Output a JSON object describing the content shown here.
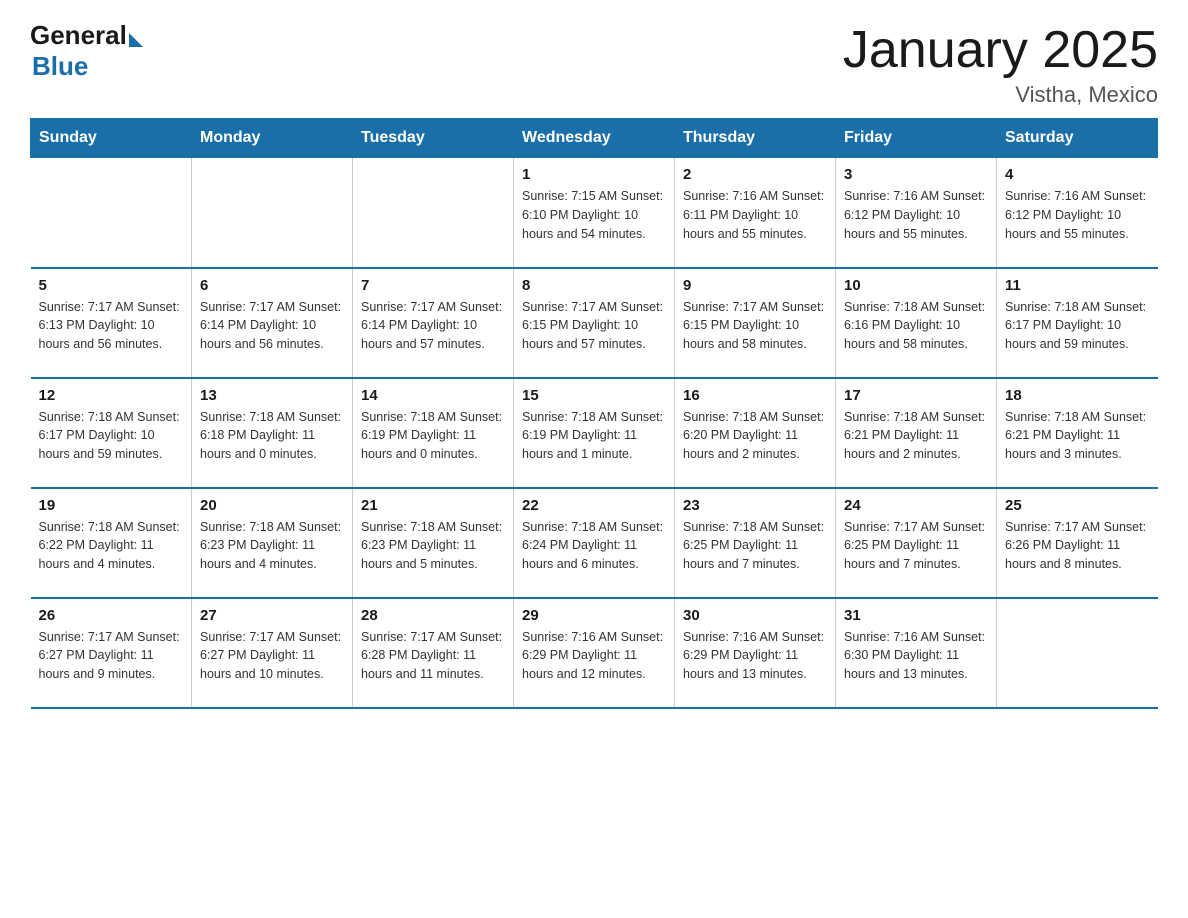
{
  "logo": {
    "general": "General",
    "blue": "Blue"
  },
  "title": "January 2025",
  "subtitle": "Vistha, Mexico",
  "days_of_week": [
    "Sunday",
    "Monday",
    "Tuesday",
    "Wednesday",
    "Thursday",
    "Friday",
    "Saturday"
  ],
  "weeks": [
    [
      {
        "day": "",
        "info": ""
      },
      {
        "day": "",
        "info": ""
      },
      {
        "day": "",
        "info": ""
      },
      {
        "day": "1",
        "info": "Sunrise: 7:15 AM\nSunset: 6:10 PM\nDaylight: 10 hours\nand 54 minutes."
      },
      {
        "day": "2",
        "info": "Sunrise: 7:16 AM\nSunset: 6:11 PM\nDaylight: 10 hours\nand 55 minutes."
      },
      {
        "day": "3",
        "info": "Sunrise: 7:16 AM\nSunset: 6:12 PM\nDaylight: 10 hours\nand 55 minutes."
      },
      {
        "day": "4",
        "info": "Sunrise: 7:16 AM\nSunset: 6:12 PM\nDaylight: 10 hours\nand 55 minutes."
      }
    ],
    [
      {
        "day": "5",
        "info": "Sunrise: 7:17 AM\nSunset: 6:13 PM\nDaylight: 10 hours\nand 56 minutes."
      },
      {
        "day": "6",
        "info": "Sunrise: 7:17 AM\nSunset: 6:14 PM\nDaylight: 10 hours\nand 56 minutes."
      },
      {
        "day": "7",
        "info": "Sunrise: 7:17 AM\nSunset: 6:14 PM\nDaylight: 10 hours\nand 57 minutes."
      },
      {
        "day": "8",
        "info": "Sunrise: 7:17 AM\nSunset: 6:15 PM\nDaylight: 10 hours\nand 57 minutes."
      },
      {
        "day": "9",
        "info": "Sunrise: 7:17 AM\nSunset: 6:15 PM\nDaylight: 10 hours\nand 58 minutes."
      },
      {
        "day": "10",
        "info": "Sunrise: 7:18 AM\nSunset: 6:16 PM\nDaylight: 10 hours\nand 58 minutes."
      },
      {
        "day": "11",
        "info": "Sunrise: 7:18 AM\nSunset: 6:17 PM\nDaylight: 10 hours\nand 59 minutes."
      }
    ],
    [
      {
        "day": "12",
        "info": "Sunrise: 7:18 AM\nSunset: 6:17 PM\nDaylight: 10 hours\nand 59 minutes."
      },
      {
        "day": "13",
        "info": "Sunrise: 7:18 AM\nSunset: 6:18 PM\nDaylight: 11 hours\nand 0 minutes."
      },
      {
        "day": "14",
        "info": "Sunrise: 7:18 AM\nSunset: 6:19 PM\nDaylight: 11 hours\nand 0 minutes."
      },
      {
        "day": "15",
        "info": "Sunrise: 7:18 AM\nSunset: 6:19 PM\nDaylight: 11 hours\nand 1 minute."
      },
      {
        "day": "16",
        "info": "Sunrise: 7:18 AM\nSunset: 6:20 PM\nDaylight: 11 hours\nand 2 minutes."
      },
      {
        "day": "17",
        "info": "Sunrise: 7:18 AM\nSunset: 6:21 PM\nDaylight: 11 hours\nand 2 minutes."
      },
      {
        "day": "18",
        "info": "Sunrise: 7:18 AM\nSunset: 6:21 PM\nDaylight: 11 hours\nand 3 minutes."
      }
    ],
    [
      {
        "day": "19",
        "info": "Sunrise: 7:18 AM\nSunset: 6:22 PM\nDaylight: 11 hours\nand 4 minutes."
      },
      {
        "day": "20",
        "info": "Sunrise: 7:18 AM\nSunset: 6:23 PM\nDaylight: 11 hours\nand 4 minutes."
      },
      {
        "day": "21",
        "info": "Sunrise: 7:18 AM\nSunset: 6:23 PM\nDaylight: 11 hours\nand 5 minutes."
      },
      {
        "day": "22",
        "info": "Sunrise: 7:18 AM\nSunset: 6:24 PM\nDaylight: 11 hours\nand 6 minutes."
      },
      {
        "day": "23",
        "info": "Sunrise: 7:18 AM\nSunset: 6:25 PM\nDaylight: 11 hours\nand 7 minutes."
      },
      {
        "day": "24",
        "info": "Sunrise: 7:17 AM\nSunset: 6:25 PM\nDaylight: 11 hours\nand 7 minutes."
      },
      {
        "day": "25",
        "info": "Sunrise: 7:17 AM\nSunset: 6:26 PM\nDaylight: 11 hours\nand 8 minutes."
      }
    ],
    [
      {
        "day": "26",
        "info": "Sunrise: 7:17 AM\nSunset: 6:27 PM\nDaylight: 11 hours\nand 9 minutes."
      },
      {
        "day": "27",
        "info": "Sunrise: 7:17 AM\nSunset: 6:27 PM\nDaylight: 11 hours\nand 10 minutes."
      },
      {
        "day": "28",
        "info": "Sunrise: 7:17 AM\nSunset: 6:28 PM\nDaylight: 11 hours\nand 11 minutes."
      },
      {
        "day": "29",
        "info": "Sunrise: 7:16 AM\nSunset: 6:29 PM\nDaylight: 11 hours\nand 12 minutes."
      },
      {
        "day": "30",
        "info": "Sunrise: 7:16 AM\nSunset: 6:29 PM\nDaylight: 11 hours\nand 13 minutes."
      },
      {
        "day": "31",
        "info": "Sunrise: 7:16 AM\nSunset: 6:30 PM\nDaylight: 11 hours\nand 13 minutes."
      },
      {
        "day": "",
        "info": ""
      }
    ]
  ]
}
